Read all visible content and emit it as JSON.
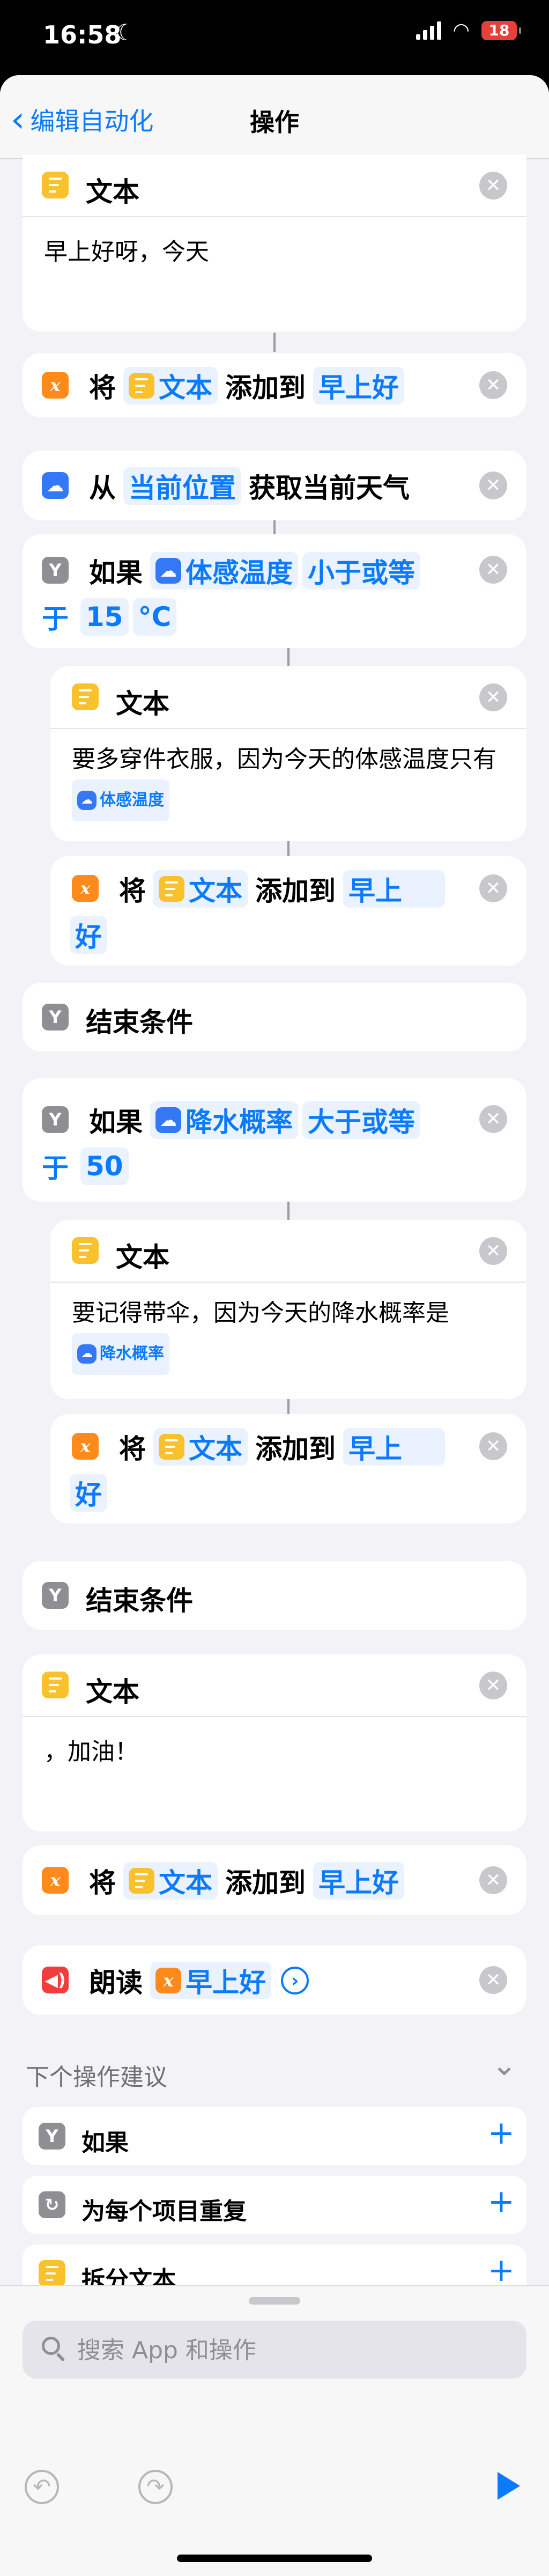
{
  "status": {
    "time": "16:58",
    "battery": "18"
  },
  "nav": {
    "back": "编辑自动化",
    "title": "操作"
  },
  "actions": {
    "text1": {
      "title": "文本",
      "body": "早上好呀，今天"
    },
    "add1": {
      "verb_left": "将",
      "var": "文本",
      "verb": "添加到",
      "target": "早上好"
    },
    "weather": {
      "from": "从",
      "location": "当前位置",
      "verb": "获取当前天气"
    },
    "if1": {
      "label": "如果",
      "var": "体感温度",
      "cond_a": "小于或等",
      "cond_b": "于",
      "value": "15",
      "unit": "°C"
    },
    "text2": {
      "title": "文本",
      "body": "要多穿件衣服，因为今天的体感温度只有",
      "var": "体感温度"
    },
    "add2": {
      "verb_left": "将",
      "var": "文本",
      "verb": "添加到",
      "target_a": "早上",
      "target_b": "好"
    },
    "end1": {
      "label": "结束条件"
    },
    "if2": {
      "label": "如果",
      "var": "降水概率",
      "cond_a": "大于或等",
      "cond_b": "于",
      "value": "50"
    },
    "text3": {
      "title": "文本",
      "body": "要记得带伞，因为今天的降水概率是",
      "var": "降水概率"
    },
    "add3": {
      "verb_left": "将",
      "var": "文本",
      "verb": "添加到",
      "target_a": "早上",
      "target_b": "好"
    },
    "end2": {
      "label": "结束条件"
    },
    "text4": {
      "title": "文本",
      "body": "，加油！"
    },
    "add4": {
      "verb_left": "将",
      "var": "文本",
      "verb": "添加到",
      "target": "早上好"
    },
    "speak": {
      "label": "朗读",
      "var": "早上好"
    }
  },
  "suggestions": {
    "title": "下个操作建议",
    "items": [
      {
        "label": "如果"
      },
      {
        "label": "为每个项目重复"
      },
      {
        "label": "拆分文本"
      }
    ]
  },
  "search": {
    "placeholder": "搜索 App 和操作"
  },
  "icons": {
    "x_glyph": "x",
    "close_glyph": "✕",
    "plus_glyph": "+",
    "chevron_glyph": "⌄",
    "back_glyph": "‹",
    "play_glyph": "›",
    "undo_glyph": "↶",
    "redo_glyph": "↷"
  },
  "colors": {
    "accent": "#0a7aff",
    "text_icon": "#f9c22c",
    "variable_icon": "#ff8a1c",
    "condition_icon": "#8e8e93",
    "weather_icon": "#3478f6",
    "speak_icon": "#f23b3b"
  }
}
